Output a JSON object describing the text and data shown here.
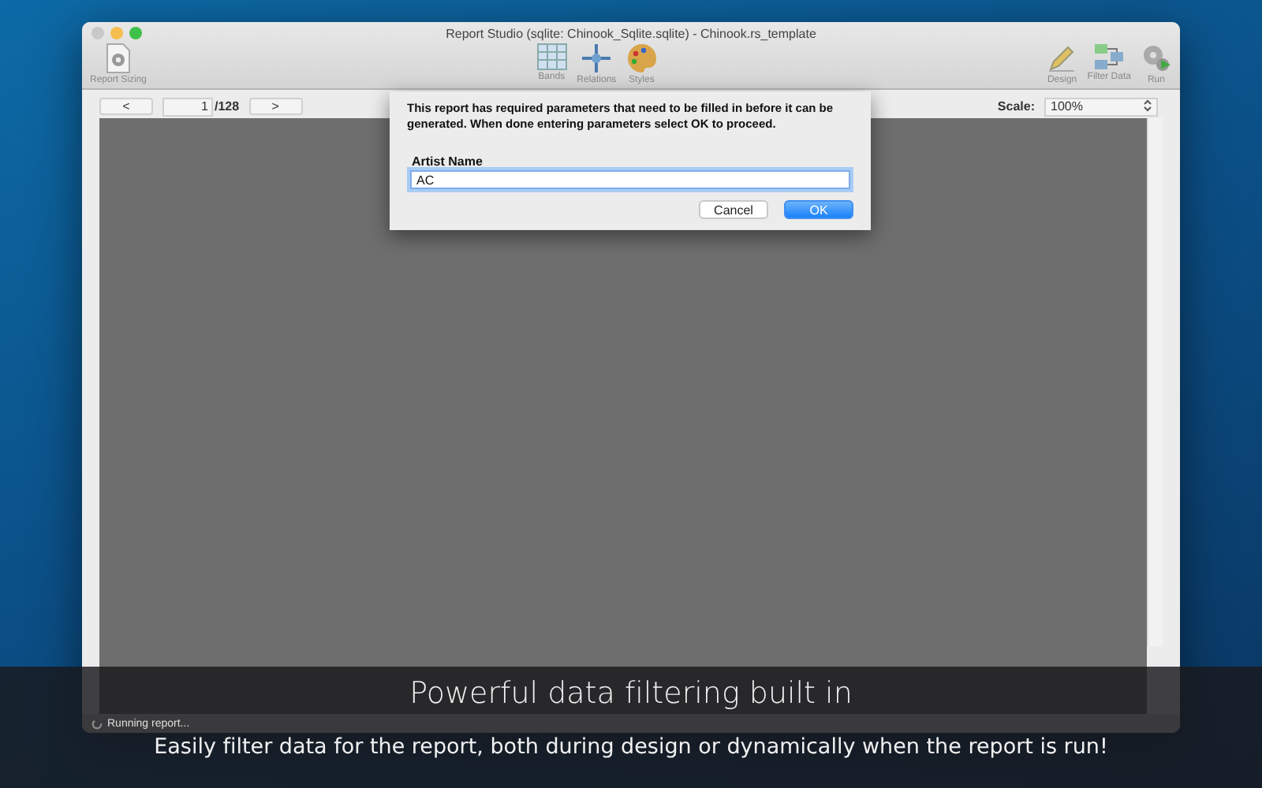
{
  "window": {
    "title": "Report Studio (sqlite: Chinook_Sqlite.sqlite) - Chinook.rs_template"
  },
  "toolbar": {
    "left": [
      {
        "label": "Report Sizing"
      }
    ],
    "center": [
      {
        "label": "Bands"
      },
      {
        "label": "Relations"
      },
      {
        "label": "Styles"
      }
    ],
    "right": [
      {
        "label": "Design"
      },
      {
        "label": "Filter Data"
      },
      {
        "label": "Run"
      }
    ]
  },
  "pager": {
    "prev": "<",
    "page": "1",
    "total": "/128",
    "next": ">"
  },
  "scale": {
    "label": "Scale:",
    "value": "100%"
  },
  "status": "Running report...",
  "dialog": {
    "message": "This report has required parameters that need to be filled in before it can be generated.  When done entering parameters select OK to proceed.",
    "field_label": "Artist Name",
    "value": "AC",
    "buttons": [
      {
        "label": "Cancel",
        "default": false
      },
      {
        "label": "OK",
        "default": true
      }
    ]
  },
  "caption": {
    "title": "Powerful data filtering built in",
    "subtitle": "Easily filter data for the report, both during design or dynamically when the report is run!"
  }
}
